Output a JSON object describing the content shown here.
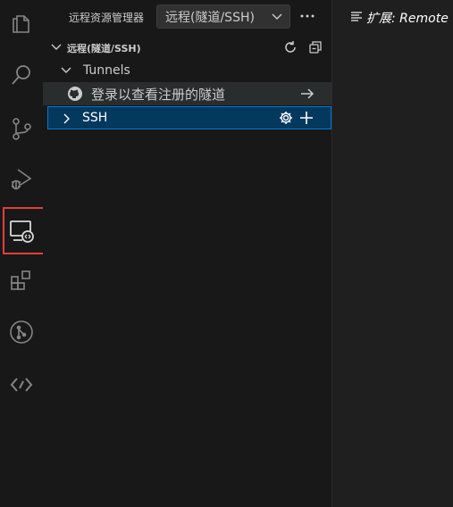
{
  "activity_bar": {
    "items": [
      {
        "name": "explorer-icon"
      },
      {
        "name": "search-icon"
      },
      {
        "name": "source-control-icon"
      },
      {
        "name": "run-debug-icon"
      },
      {
        "name": "remote-explorer-icon",
        "active": true,
        "highlighted": true
      },
      {
        "name": "extensions-icon"
      },
      {
        "name": "git-graph-icon"
      },
      {
        "name": "remote-code-icon"
      }
    ],
    "highlight_color": "#e0403a"
  },
  "sidebar": {
    "title": "远程资源管理器",
    "dropdown_value": "远程(隧道/SSH)",
    "more_icon": "ellipsis-icon",
    "section": {
      "label": "远程(隧道/SSH)",
      "actions": [
        "refresh-icon",
        "collapse-all-icon"
      ]
    },
    "tree": {
      "tunnels_label": "Tunnels",
      "login_label": "登录以查看注册的隧道",
      "ssh_label": "SSH"
    }
  },
  "editor": {
    "tab_label": "扩展: Remote -",
    "tab_icon": "preview-icon"
  },
  "colors": {
    "selection_bg": "#04395e",
    "selection_border": "#0078d4",
    "background": "#1f1f1f",
    "sidebar_bg": "#181818"
  }
}
